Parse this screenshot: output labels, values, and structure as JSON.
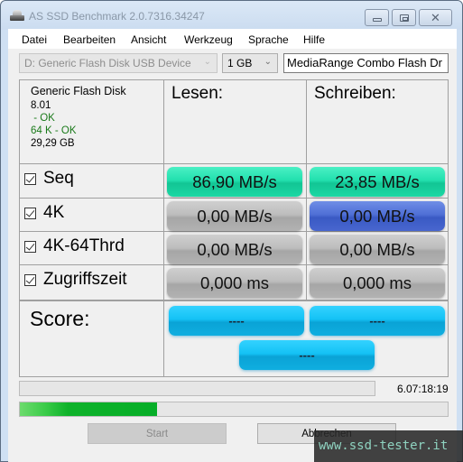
{
  "window": {
    "title": "AS SSD Benchmark 2.0.7316.34247",
    "controls": {
      "minimize": "minimize",
      "maximize": "maximize",
      "close": "close"
    }
  },
  "menu": {
    "items": [
      {
        "label": "Datei"
      },
      {
        "label": "Bearbeiten"
      },
      {
        "label": "Ansicht"
      },
      {
        "label": "Werkzeug"
      },
      {
        "label": "Sprache"
      },
      {
        "label": "Hilfe"
      }
    ]
  },
  "toolbar": {
    "drive_select": {
      "value": "D: Generic Flash Disk USB Device",
      "disabled": true
    },
    "size_select": {
      "value": "1 GB"
    },
    "name_input": {
      "value": "MediaRange Combo Flash Dr"
    }
  },
  "device_info": {
    "name": "Generic Flash Disk",
    "firmware": "8.01",
    "driver_status": " - OK",
    "alignment_status": "64 K - OK",
    "capacity": "29,29 GB"
  },
  "columns": {
    "read": "Lesen:",
    "write": "Schreiben:"
  },
  "tests": [
    {
      "label": "Seq",
      "checked": true,
      "read": "86,90 MB/s",
      "write": "23,85 MB/s",
      "read_state": "done",
      "write_state": "done"
    },
    {
      "label": "4K",
      "checked": true,
      "read": "0,00 MB/s",
      "write": "0,00 MB/s",
      "read_state": "pending",
      "write_state": "running"
    },
    {
      "label": "4K-64Thrd",
      "checked": true,
      "read": "0,00 MB/s",
      "write": "0,00 MB/s",
      "read_state": "pending",
      "write_state": "pending"
    },
    {
      "label": "Zugriffszeit",
      "checked": true,
      "read": "0,000 ms",
      "write": "0,000 ms",
      "read_state": "pending",
      "write_state": "pending"
    }
  ],
  "score": {
    "label": "Score:",
    "read": "----",
    "write": "----",
    "total": "----"
  },
  "progress": {
    "elapsed": "6.07:18:19",
    "test_progress_percent": 0,
    "overall_progress_percent": 32
  },
  "buttons": {
    "start": "Start",
    "cancel": "Abbrechen"
  },
  "colors": {
    "done": "#22e0ae",
    "running": "#4f6fd6",
    "pending": "#bdbdbd",
    "score": "#14c2f5",
    "progress": "#06ae28"
  },
  "watermark": "www.ssd-tester.it"
}
